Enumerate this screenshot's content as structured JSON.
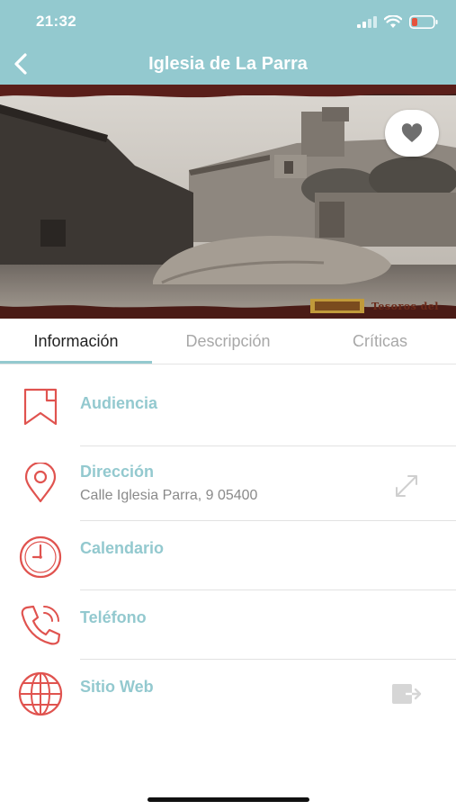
{
  "status_bar": {
    "time": "21:32"
  },
  "nav": {
    "title": "Iglesia de La Parra",
    "back_icon": "chevron-left-icon"
  },
  "hero": {
    "watermark": "Tesoros del"
  },
  "tabs": [
    {
      "label": "Información",
      "active": true
    },
    {
      "label": "Descripción",
      "active": false
    },
    {
      "label": "Críticas",
      "active": false
    }
  ],
  "rows": [
    {
      "label": "Audiencia",
      "value": "",
      "icon": "bookmark-icon"
    },
    {
      "label": "Dirección",
      "value": "Calle Iglesia Parra, 9 05400",
      "icon": "location-pin-icon",
      "action_icon": "expand-icon"
    },
    {
      "label": "Calendario",
      "value": "",
      "icon": "clock-icon"
    },
    {
      "label": "Teléfono",
      "value": "",
      "icon": "phone-icon"
    },
    {
      "label": "Sitio Web",
      "value": "",
      "icon": "globe-icon",
      "action_icon": "open-external-icon"
    }
  ],
  "colors": {
    "accent": "#93c9cf",
    "icon_red": "#e0534f"
  }
}
